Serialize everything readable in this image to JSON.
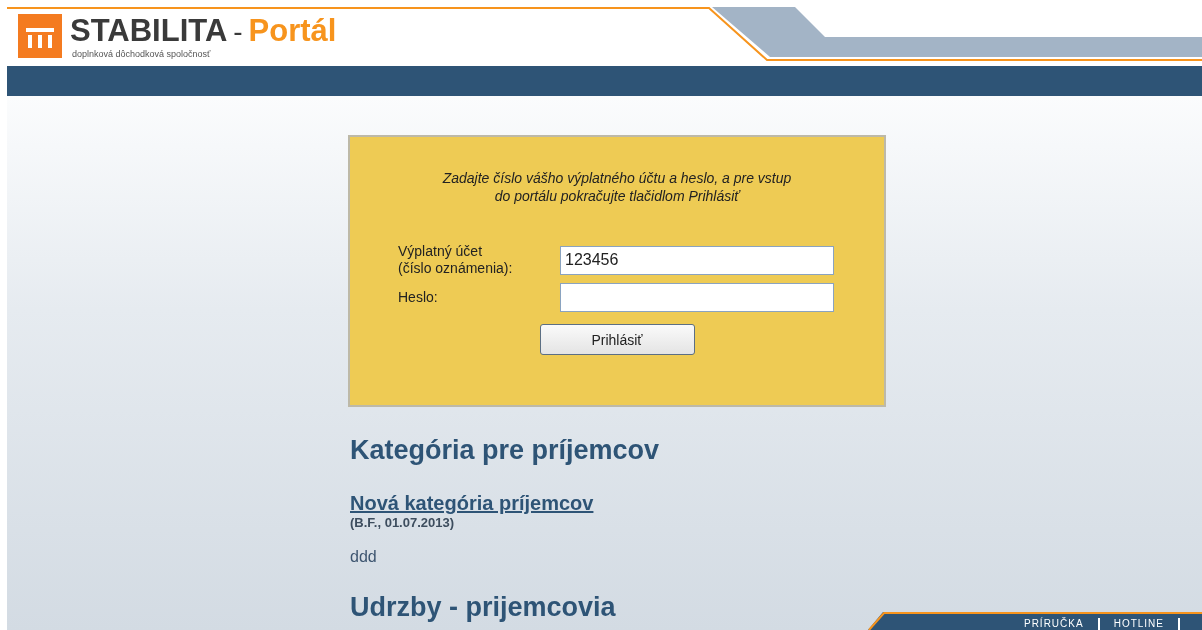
{
  "header": {
    "brand": "STABILITA",
    "separator": "-",
    "product": "Portál",
    "tagline": "doplnková dôchodková spoločnosť"
  },
  "login": {
    "instruction": "Zadajte číslo vášho výplatného účtu a heslo, a pre vstup\ndo portálu pokračujte tlačidlom Prihlásiť",
    "fields": [
      {
        "label": "Výplatný účet\n(číslo oznámenia):",
        "value": "123456",
        "kind": "text"
      },
      {
        "label": "Heslo:",
        "kind": "password"
      }
    ],
    "button": "Prihlásiť"
  },
  "sections": [
    {
      "heading": "Kategória pre príjemcov",
      "articles": [
        {
          "title": "Nová kategória príjemcov",
          "meta": "(B.F., 01.07.2013)",
          "body": "ddd"
        }
      ]
    },
    {
      "heading": "Udrzby - prijemcovia"
    }
  ],
  "footer_links": [
    "PRÍRUČKA",
    "HOTLINE"
  ]
}
